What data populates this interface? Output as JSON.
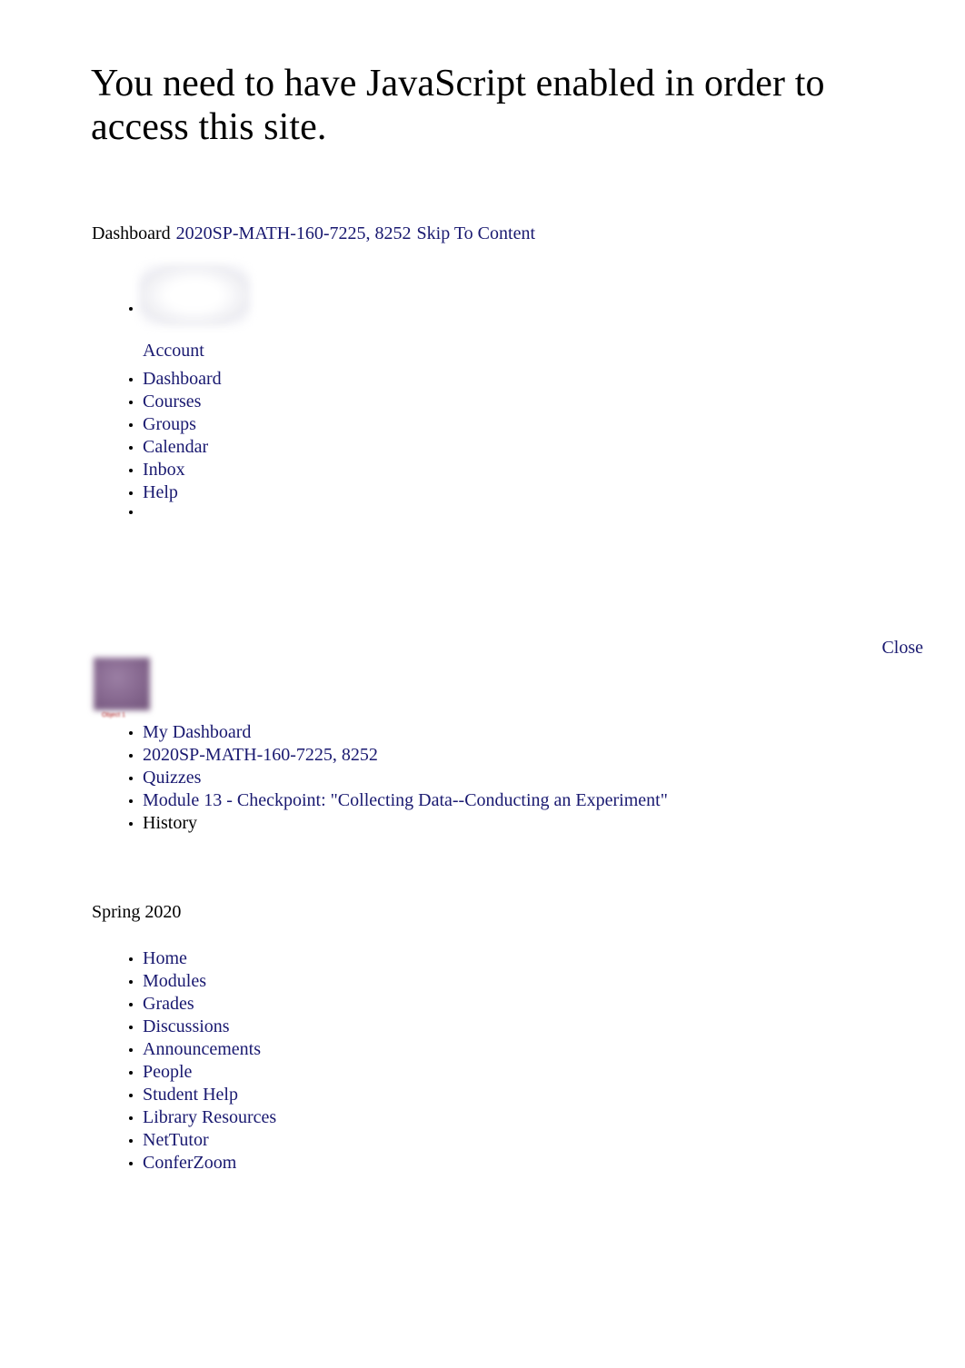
{
  "page": {
    "js_warning": "You need to have JavaScript enabled in order to access this site."
  },
  "breadcrumb": {
    "dashboard_label": "Dashboard",
    "course_link": "2020SP-MATH-160-7225, 8252",
    "skip_link": "Skip To Content"
  },
  "global_nav": {
    "avatar_alt": "",
    "items": [
      {
        "label": "Account",
        "is_link": true,
        "has_avatar": true
      },
      {
        "label": "Dashboard",
        "is_link": true
      },
      {
        "label": "Courses",
        "is_link": true
      },
      {
        "label": "Groups",
        "is_link": true
      },
      {
        "label": "Calendar",
        "is_link": true
      },
      {
        "label": "Inbox",
        "is_link": true
      },
      {
        "label": "Help",
        "is_link": true
      },
      {
        "label": "",
        "is_link": false
      }
    ]
  },
  "tray": {
    "close_label": "Close"
  },
  "course_thumbnail": {
    "alt_text": "Object 1",
    "color": "#8a6c93"
  },
  "context_nav": {
    "items": [
      {
        "label": "My Dashboard",
        "is_link": true
      },
      {
        "label": "2020SP-MATH-160-7225, 8252",
        "is_link": true
      },
      {
        "label": "Quizzes",
        "is_link": true
      },
      {
        "label": "Module 13 - Checkpoint: \"Collecting Data--Conducting an Experiment\"",
        "is_link": true
      },
      {
        "label": "History",
        "is_link": false
      }
    ]
  },
  "term": {
    "label": "Spring 2020"
  },
  "course_nav": {
    "items": [
      {
        "label": "Home",
        "is_link": true
      },
      {
        "label": "Modules",
        "is_link": true
      },
      {
        "label": "Grades",
        "is_link": true
      },
      {
        "label": "Discussions",
        "is_link": true
      },
      {
        "label": "Announcements",
        "is_link": true
      },
      {
        "label": "People",
        "is_link": true
      },
      {
        "label": "Student Help",
        "is_link": true
      },
      {
        "label": "Library Resources",
        "is_link": true
      },
      {
        "label": "NetTutor",
        "is_link": true
      },
      {
        "label": "ConferZoom",
        "is_link": true
      }
    ]
  },
  "colors": {
    "link": "#191970",
    "text": "#000000",
    "background": "#ffffff",
    "thumbnail_purple": "#8a6c93",
    "alt_text_red": "#b02020"
  }
}
